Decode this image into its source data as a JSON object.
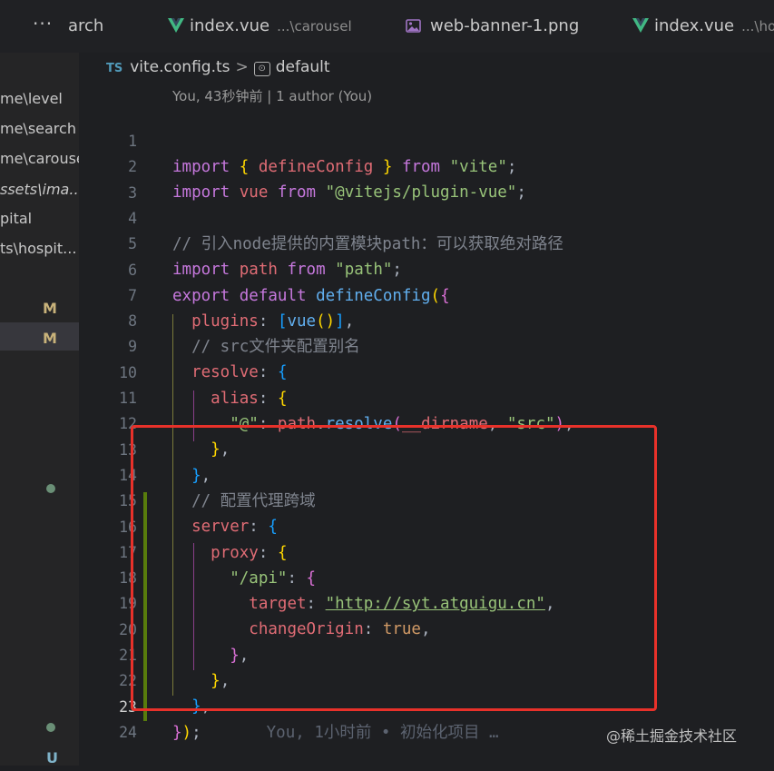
{
  "tabs": [
    {
      "label": "arch",
      "path": "",
      "icon": "none"
    },
    {
      "label": "index.vue",
      "path": "...\\carousel",
      "icon": "vue-icon"
    },
    {
      "label": "web-banner-1.png",
      "path": "",
      "icon": "image-icon"
    },
    {
      "label": "index.vue",
      "path": "...\\hos",
      "icon": "vue-icon"
    }
  ],
  "more_actions": "···",
  "sidebar": {
    "items": [
      "me\\level",
      "me\\search",
      "me\\carousel",
      "ssets\\ima...",
      "pital",
      "ts\\hospit..."
    ],
    "badges": [
      "M",
      "M"
    ],
    "bottom_badge": "U"
  },
  "breadcrumb": {
    "lang": "TS",
    "file": "vite.config.ts",
    "separator": ">",
    "symbol": "default"
  },
  "codelens": "You, 43秒钟前 | 1 author (You)",
  "lines": [
    {
      "n": "1"
    },
    {
      "n": "2"
    },
    {
      "n": "3"
    },
    {
      "n": "4"
    },
    {
      "n": "5"
    },
    {
      "n": "6"
    },
    {
      "n": "7"
    },
    {
      "n": "8"
    },
    {
      "n": "9"
    },
    {
      "n": "10"
    },
    {
      "n": "11"
    },
    {
      "n": "12"
    },
    {
      "n": "13"
    },
    {
      "n": "14"
    },
    {
      "n": "15"
    },
    {
      "n": "16"
    },
    {
      "n": "17"
    },
    {
      "n": "18"
    },
    {
      "n": "19"
    },
    {
      "n": "20"
    },
    {
      "n": "21"
    },
    {
      "n": "22"
    },
    {
      "n": "23"
    },
    {
      "n": "24"
    }
  ],
  "code": {
    "l1": {
      "k1": "import",
      "b1": "{",
      "fn": "defineConfig",
      "b2": "}",
      "k2": "from",
      "s": "\"vite\"",
      "e": ";"
    },
    "l2": {
      "k1": "import",
      "v": "vue",
      "k2": "from",
      "s": "\"@vitejs/plugin-vue\"",
      "e": ";"
    },
    "l4": {
      "c": "// 引入node提供的内置模块path：可以获取绝对路径"
    },
    "l5": {
      "k1": "import",
      "v": "path",
      "k2": "from",
      "s": "\"path\"",
      "e": ";"
    },
    "l6": {
      "k1": "export",
      "k2": "default",
      "fn": "defineConfig",
      "b1": "(",
      "b2": "{"
    },
    "l7": {
      "p": "plugins",
      "c": ":",
      "b1": "[",
      "fn": "vue",
      "b2": "()",
      "b3": "]",
      "e": ","
    },
    "l8": {
      "c": "// src文件夹配置别名"
    },
    "l9": {
      "p": "resolve",
      "c": ":",
      "b": "{"
    },
    "l10": {
      "p": "alias",
      "c": ":",
      "b": "{"
    },
    "l11": {
      "s": "\"@\"",
      "c": ":",
      "v": "path",
      "d": ".",
      "fn": "resolve",
      "b1": "(",
      "a": "__dirname",
      "cm": ",",
      "s2": "\"src\"",
      "b2": ")",
      "e": ","
    },
    "l12": {
      "b": "}",
      "e": ","
    },
    "l13": {
      "b": "}",
      "e": ","
    },
    "l14": {
      "c": "// 配置代理跨域"
    },
    "l15": {
      "p": "server",
      "c": ":",
      "b": "{"
    },
    "l16": {
      "p": "proxy",
      "c": ":",
      "b": "{"
    },
    "l17": {
      "s": "\"/api\"",
      "c": ":",
      "b": "{"
    },
    "l18": {
      "p": "target",
      "c": ":",
      "s": "\"http://syt.atguigu.cn\"",
      "e": ","
    },
    "l19": {
      "p": "changeOrigin",
      "c": ":",
      "v": "true",
      "e": ","
    },
    "l20": {
      "b": "}",
      "e": ","
    },
    "l21": {
      "b": "}",
      "e": ","
    },
    "l22": {
      "b": "}",
      "e": ","
    },
    "l23": {
      "b1": "}",
      "b2": ")",
      "e": ";",
      "blame": "You, 1小时前 • 初始化项目 …"
    }
  },
  "watermark": "@稀土掘金技术社区",
  "colors": {
    "highlight_box": "#e8312a",
    "git_modified": "#587c0c"
  }
}
